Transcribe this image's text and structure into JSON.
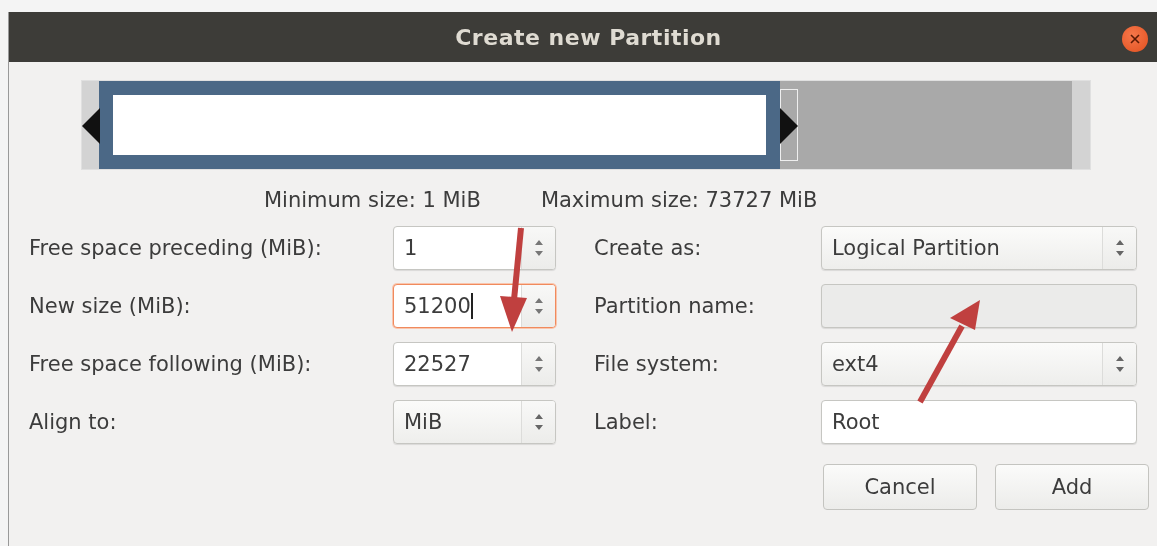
{
  "window": {
    "title": "Create new Partition"
  },
  "partition_bar": {
    "level": 0.7
  },
  "min_size": "Minimum size: 1 MiB",
  "max_size": "Maximum size: 73727 MiB",
  "left_fields": [
    {
      "label": "Free space preceding (MiB):",
      "kind": "spin",
      "value": "1",
      "focused": false
    },
    {
      "label": "New size (MiB):",
      "kind": "spin",
      "value": "51200",
      "focused": true
    },
    {
      "label": "Free space following (MiB):",
      "kind": "spin",
      "value": "22527",
      "focused": false
    },
    {
      "label": "Align to:",
      "kind": "combo",
      "value": "MiB"
    }
  ],
  "right_fields": [
    {
      "label": "Create as:",
      "kind": "combo",
      "value": "Logical Partition"
    },
    {
      "label": "Partition name:",
      "kind": "entry",
      "disabled": true
    },
    {
      "label": "File system:",
      "kind": "combo",
      "value": "ext4"
    },
    {
      "label": "Label:",
      "kind": "entry",
      "value": "Root",
      "disabled": false
    }
  ],
  "buttons": [
    "Cancel",
    "Add"
  ]
}
